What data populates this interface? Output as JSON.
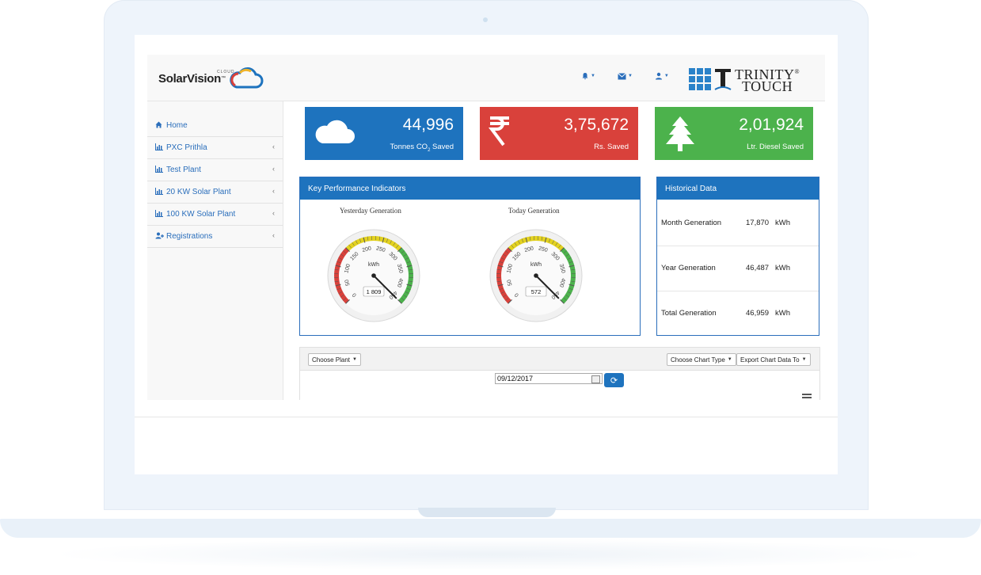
{
  "header": {
    "logo_text": "SolarVision",
    "logo_tm": "™",
    "logo_sub": "CLOUD",
    "brand_line1": "TRINITY",
    "brand_reg": "®",
    "brand_line2": "TOUCH",
    "icons": [
      "bell-icon",
      "envelope-icon",
      "user-icon"
    ]
  },
  "sidebar": {
    "items": [
      {
        "label": "Home",
        "icon": "home-icon"
      },
      {
        "label": "PXC Prithla",
        "icon": "bar-chart-icon"
      },
      {
        "label": "Test Plant",
        "icon": "bar-chart-icon"
      },
      {
        "label": "20 KW Solar Plant",
        "icon": "bar-chart-icon"
      },
      {
        "label": "100 KW Solar Plant",
        "icon": "bar-chart-icon"
      },
      {
        "label": "Registrations",
        "icon": "user-plus-icon"
      }
    ]
  },
  "stats": [
    {
      "value": "44,996",
      "caption_pre": "Tonnes CO",
      "caption_sub": "2",
      "caption_post": " Saved",
      "color": "#1e73be",
      "icon": "cloud-icon"
    },
    {
      "value": "3,75,672",
      "caption": "Rs. Saved",
      "color": "#d9413b",
      "icon": "rupee-icon"
    },
    {
      "value": "2,01,924",
      "caption": "Ltr. Diesel Saved",
      "color": "#4cb24c",
      "icon": "tree-icon"
    }
  ],
  "kpi": {
    "title": "Key Performance Indicators",
    "unit": "kWh",
    "ticks": [
      "0",
      "50",
      "100",
      "150",
      "200",
      "250",
      "300",
      "350",
      "400",
      "450"
    ],
    "gauges": [
      {
        "title": "Yesterday Generation",
        "value": 1809,
        "display": "1 809"
      },
      {
        "title": "Today Generation",
        "value": 572,
        "display": "572"
      }
    ]
  },
  "history": {
    "title": "Historical Data",
    "rows": [
      {
        "label": "Month Generation",
        "value": "17,870",
        "unit": "kWh"
      },
      {
        "label": "Year Generation",
        "value": "46,487",
        "unit": "kWh"
      },
      {
        "label": "Total Generation",
        "value": "46,959",
        "unit": "kWh"
      }
    ]
  },
  "chart_controls": {
    "choose_plant": "Choose Plant",
    "choose_chart_type": "Choose Chart Type",
    "export": "Export Chart Data To",
    "date": "09/12/2017"
  }
}
